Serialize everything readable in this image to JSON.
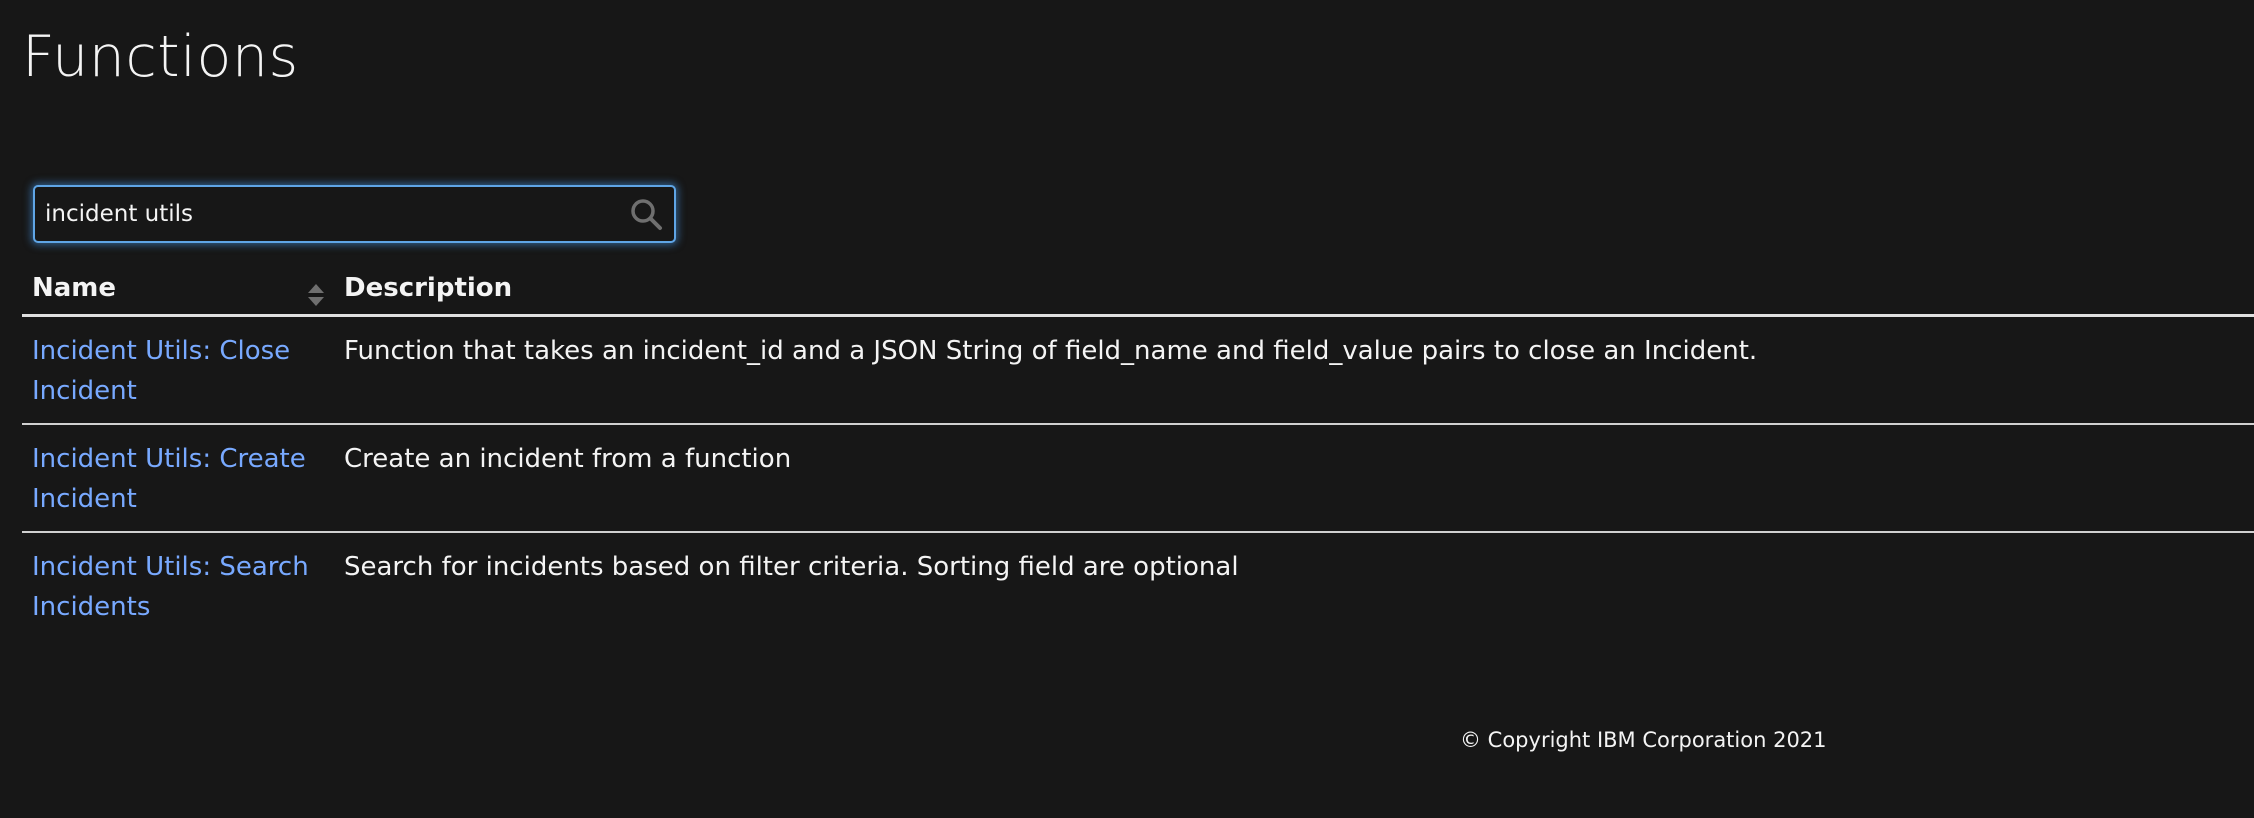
{
  "page": {
    "title": "Functions"
  },
  "search": {
    "value": "incident utils",
    "icon": "search-icon"
  },
  "table": {
    "columns": [
      "Name",
      "Description"
    ],
    "sort_icon": "sort-icon",
    "rows": [
      {
        "name": "Incident Utils: Close Incident",
        "description": "Function that takes an incident_id and a JSON String of field_name and field_value pairs to close an Incident."
      },
      {
        "name": "Incident Utils: Create Incident",
        "description": "Create an incident from a function"
      },
      {
        "name": "Incident Utils: Search Incidents",
        "description": "Search for incidents based on filter criteria. Sorting field are optional"
      }
    ]
  },
  "footer": {
    "copyright": "© Copyright IBM Corporation 2021"
  },
  "colors": {
    "background": "#171717",
    "text": "#f4f4f4",
    "link": "#78a9ff",
    "focus": "#5fa5e6"
  }
}
